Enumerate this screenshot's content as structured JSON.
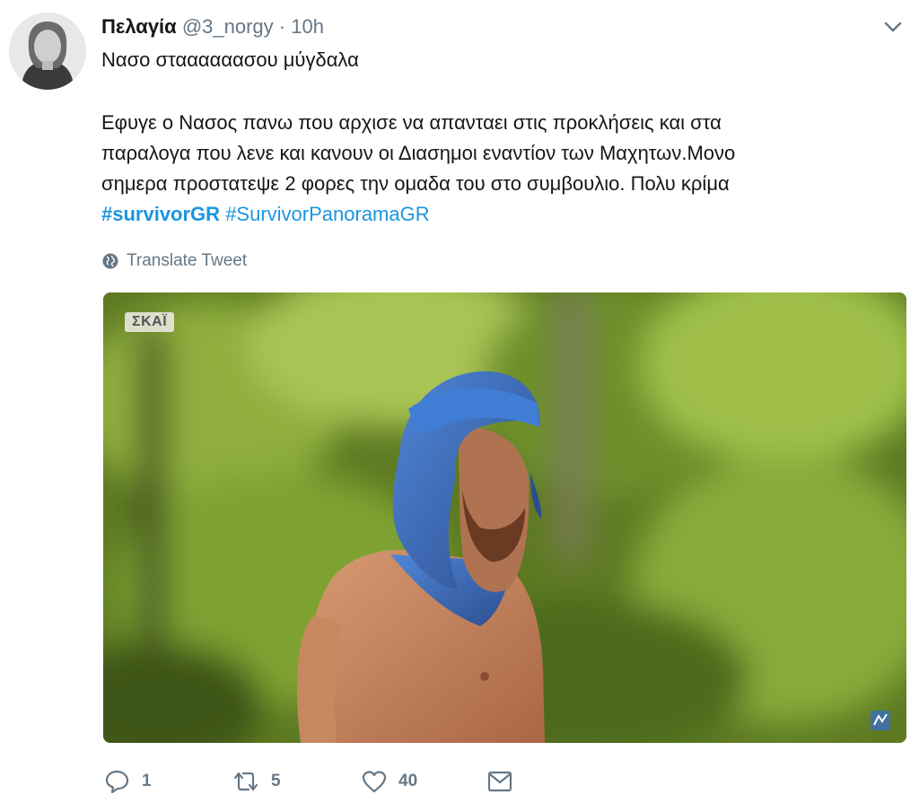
{
  "tweet": {
    "author_name": "Πελαγία",
    "handle": "@3_norgy",
    "separator": "·",
    "time": "10h",
    "first_line": "Νασο σταααααασου μύγδαλα",
    "body_lines": [
      "Εφυγε ο Νασος πανω που αρχισε να απανταει στις προκλήσεις και στα",
      "παραλογα που λενε και κανουν οι Διασημοι εναντίον των Μαχητων.Μονο",
      "σημερα προστατεψε 2 φορες την ομαδα του στο συμβουλιο. Πολυ κρίμα"
    ],
    "hashtags": [
      "#survivorGR",
      "#SurvivorPanoramaGR"
    ],
    "translate_label": "Translate Tweet",
    "media": {
      "channel_watermark": "ΣΚΑΪ"
    },
    "actions": {
      "reply_count": "1",
      "retweet_count": "5",
      "like_count": "40"
    }
  },
  "icons": {
    "menu": "chevron-down-icon",
    "translate": "globe-icon",
    "reply": "reply-icon",
    "retweet": "retweet-icon",
    "like": "heart-icon",
    "dm": "envelope-icon"
  },
  "colors": {
    "link": "#1b95e0",
    "secondary_text": "#657786",
    "primary_text": "#14171a"
  }
}
